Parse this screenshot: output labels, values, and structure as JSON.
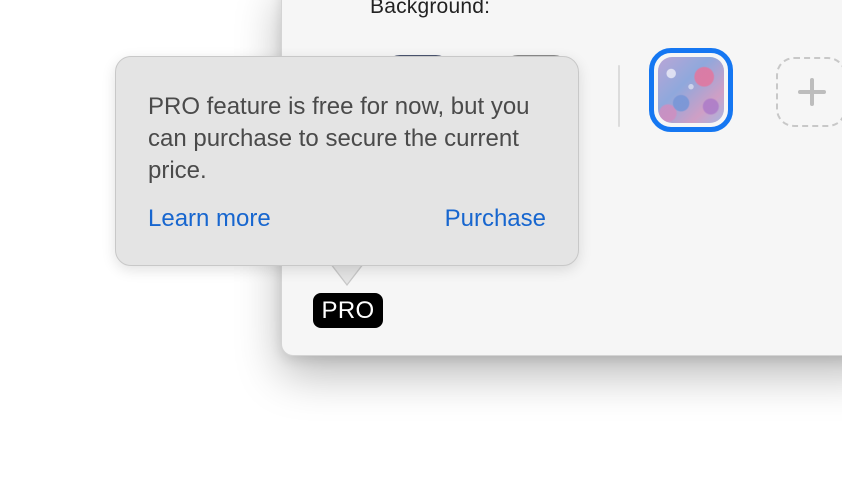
{
  "window": {
    "background_label": "Background:",
    "swatches": [
      {
        "name": "dark-swatch",
        "color": "#4b5570",
        "selected": false
      },
      {
        "name": "gray-swatch",
        "color": "#8a8a8a",
        "selected": false
      },
      {
        "name": "marble-texture-swatch",
        "selected": true
      },
      {
        "name": "add-swatch",
        "icon": "plus-icon"
      }
    ],
    "selection_color": "#1577f2"
  },
  "popover": {
    "message": "PRO feature is free for now, but you can purchase to secure the current price.",
    "learn_more_label": "Learn more",
    "purchase_label": "Purchase",
    "link_color": "#1766cf"
  },
  "badge": {
    "label": "PRO"
  }
}
